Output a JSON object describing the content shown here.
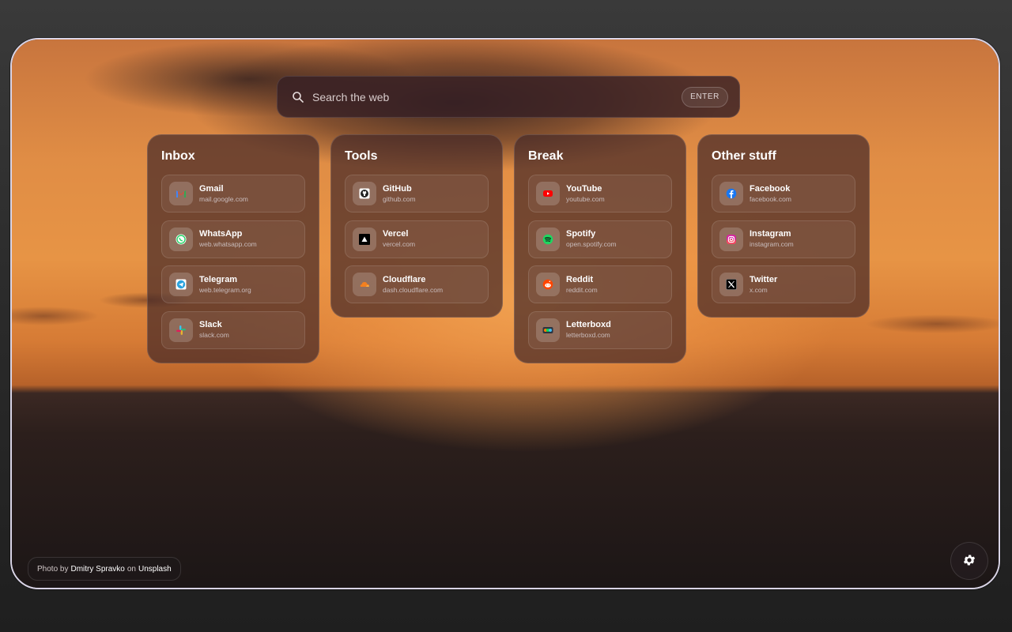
{
  "search": {
    "placeholder": "Search the web",
    "enter_label": "ENTER"
  },
  "groups": [
    {
      "title": "Inbox",
      "links": [
        {
          "name": "Gmail",
          "url": "mail.google.com",
          "icon": "gmail-icon"
        },
        {
          "name": "WhatsApp",
          "url": "web.whatsapp.com",
          "icon": "whatsapp-icon"
        },
        {
          "name": "Telegram",
          "url": "web.telegram.org",
          "icon": "telegram-icon"
        },
        {
          "name": "Slack",
          "url": "slack.com",
          "icon": "slack-icon"
        }
      ]
    },
    {
      "title": "Tools",
      "links": [
        {
          "name": "GitHub",
          "url": "github.com",
          "icon": "github-icon"
        },
        {
          "name": "Vercel",
          "url": "vercel.com",
          "icon": "vercel-icon"
        },
        {
          "name": "Cloudflare",
          "url": "dash.cloudflare.com",
          "icon": "cloudflare-icon"
        }
      ]
    },
    {
      "title": "Break",
      "links": [
        {
          "name": "YouTube",
          "url": "youtube.com",
          "icon": "youtube-icon"
        },
        {
          "name": "Spotify",
          "url": "open.spotify.com",
          "icon": "spotify-icon"
        },
        {
          "name": "Reddit",
          "url": "reddit.com",
          "icon": "reddit-icon"
        },
        {
          "name": "Letterboxd",
          "url": "letterboxd.com",
          "icon": "letterboxd-icon"
        }
      ]
    },
    {
      "title": "Other stuff",
      "links": [
        {
          "name": "Facebook",
          "url": "facebook.com",
          "icon": "facebook-icon"
        },
        {
          "name": "Instagram",
          "url": "instagram.com",
          "icon": "instagram-icon"
        },
        {
          "name": "Twitter",
          "url": "x.com",
          "icon": "x-icon"
        }
      ]
    }
  ],
  "credit": {
    "prefix": "Photo by",
    "author": "Dmitry Spravko",
    "middle": "on",
    "source": "Unsplash"
  },
  "colors": {
    "accent_border": "#d9d4e6",
    "sunset": "#e08d45",
    "sea": "#1c1616"
  }
}
